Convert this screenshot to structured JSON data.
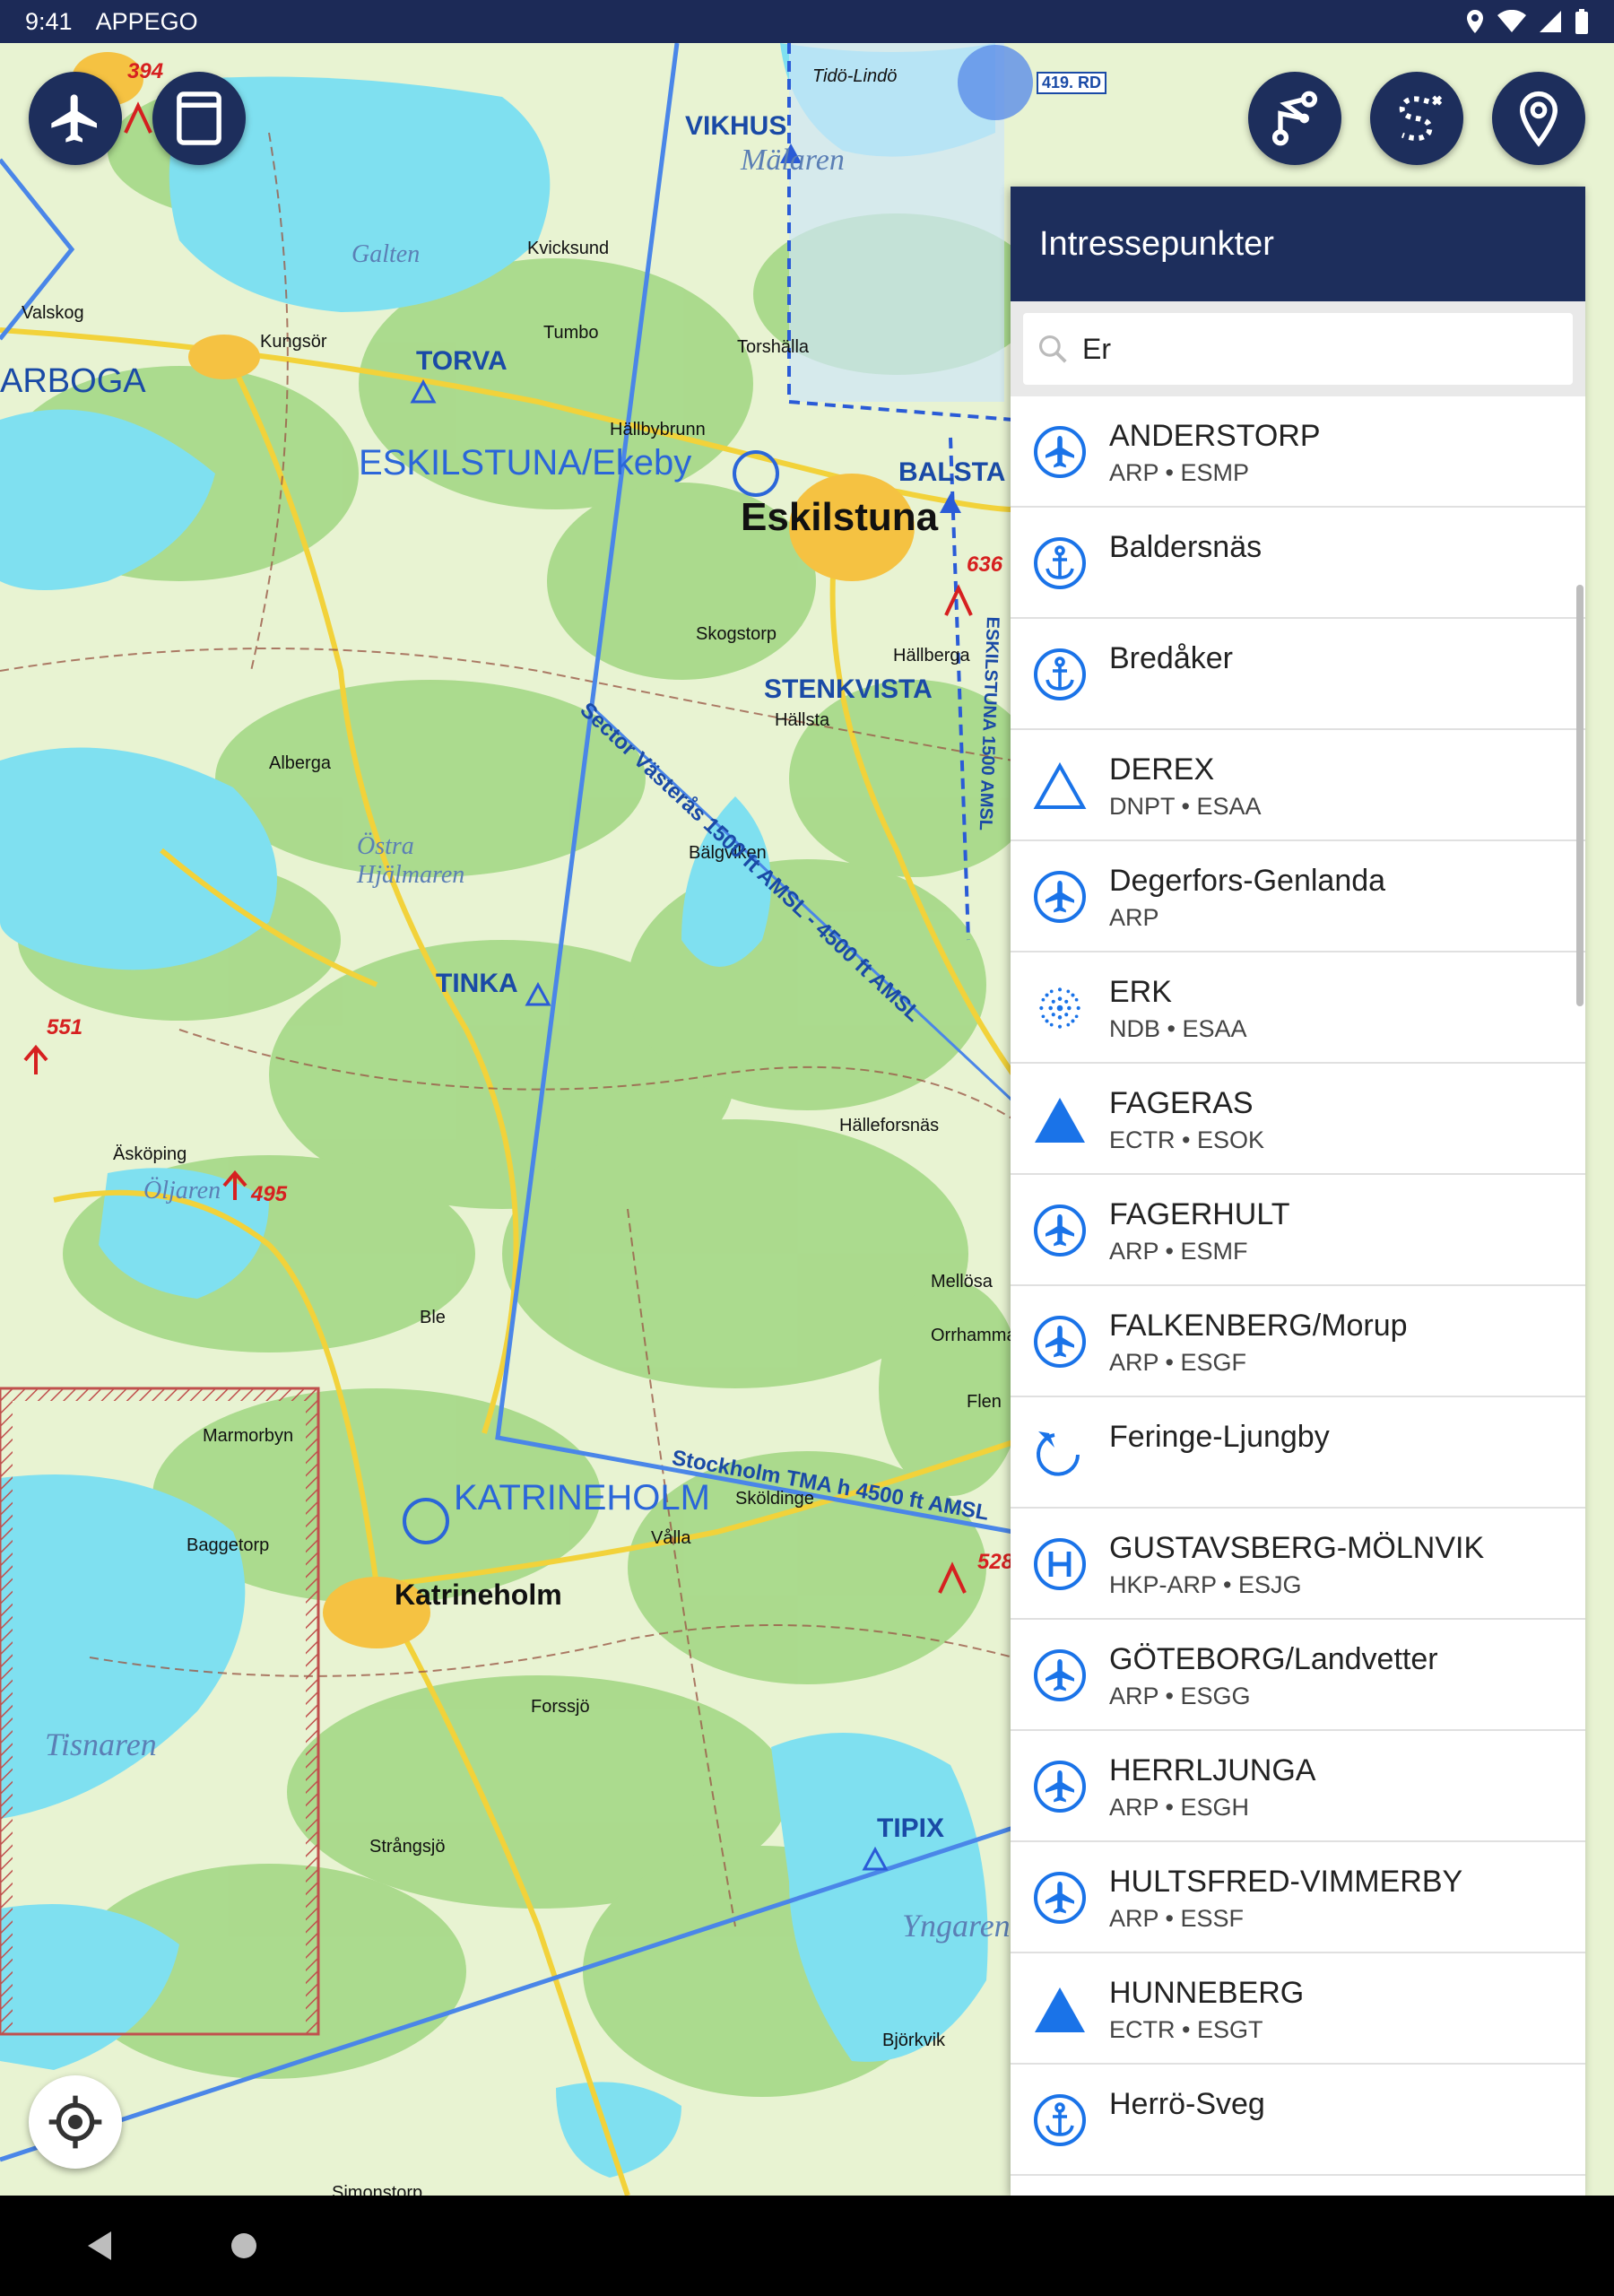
{
  "status_bar": {
    "time": "9:41",
    "app": "APPEGO"
  },
  "map_labels": {
    "towns": [
      "Kvicksund",
      "Kungsör",
      "Tumbo",
      "Torshälla",
      "Valskog",
      "Hällbybrunn",
      "Skogstorp",
      "Hällberga",
      "Hällsta",
      "Alberga",
      "Bälgviken",
      "Hälleforsnäs",
      "Äsköping",
      "Mellösa",
      "Orrhammar",
      "Flen",
      "Ble",
      "Marmorbyn",
      "Baggetorp",
      "Vålla",
      "Sköldinge",
      "Forssjö",
      "Strångsjö",
      "Björkvik",
      "Simonstorp",
      "Tidö-Lindö"
    ],
    "big_town": "Eskilstuna",
    "town_katrineholm": "Katrineholm",
    "lakes": [
      "Galten",
      "Mälaren",
      "Östra Hjälmaren",
      "Öljaren",
      "Tisnaren",
      "Yngaren"
    ],
    "waypoints": [
      "VIKHUS",
      "TORVA",
      "BALSTA",
      "STENKVISTA",
      "TINKA",
      "TIPIX",
      "ARBOGA"
    ],
    "airports": [
      "ESKILSTUNA/Ekeby",
      "KATRINEHOLM"
    ],
    "sectors": [
      "Sector Västerås 1500 ft AMSL - 4500 ft AMSL",
      "Stockholm TMA h 4500 ft AMSL",
      "ESKILSTUNA 1500 AMSL"
    ],
    "obstacles": [
      "394",
      "636",
      "551",
      "495",
      "528"
    ],
    "restricted": "419. RD"
  },
  "poi_panel": {
    "title": "Intressepunkter",
    "search": {
      "value": "Er"
    },
    "items": [
      {
        "name": "ANDERSTORP",
        "sub": "ARP • ESMP",
        "icon": "airport-icon"
      },
      {
        "name": "Baldersnäs",
        "sub": "",
        "icon": "anchor-icon"
      },
      {
        "name": "Bredåker",
        "sub": "",
        "icon": "anchor-icon"
      },
      {
        "name": "DEREX",
        "sub": "DNPT • ESAA",
        "icon": "triangle-outline-icon"
      },
      {
        "name": "Degerfors-Genlanda",
        "sub": "ARP",
        "icon": "airport-icon"
      },
      {
        "name": "ERK",
        "sub": "NDB • ESAA",
        "icon": "ndb-icon"
      },
      {
        "name": "FAGERAS",
        "sub": "ECTR • ESOK",
        "icon": "triangle-filled-icon"
      },
      {
        "name": "FAGERHULT",
        "sub": "ARP • ESMF",
        "icon": "airport-icon"
      },
      {
        "name": "FALKENBERG/Morup",
        "sub": "ARP • ESGF",
        "icon": "airport-icon"
      },
      {
        "name": "Feringe-Ljungby",
        "sub": "",
        "icon": "glider-icon"
      },
      {
        "name": "GUSTAVSBERG-MÖLNVIK",
        "sub": "HKP-ARP • ESJG",
        "icon": "heliport-icon"
      },
      {
        "name": "GÖTEBORG/Landvetter",
        "sub": "ARP • ESGG",
        "icon": "airport-icon"
      },
      {
        "name": "HERRLJUNGA",
        "sub": "ARP • ESGH",
        "icon": "airport-icon"
      },
      {
        "name": "HULTSFRED-VIMMERBY",
        "sub": "ARP • ESSF",
        "icon": "airport-icon"
      },
      {
        "name": "HUNNEBERG",
        "sub": "ECTR • ESGT",
        "icon": "triangle-filled-icon"
      },
      {
        "name": "Herrö-Sveg",
        "sub": "",
        "icon": "anchor-icon"
      }
    ]
  },
  "colors": {
    "header": "#1d2e5c",
    "accent": "#1a73e8",
    "water": "#7fe0f0",
    "land": "#e8f3d2",
    "forest": "#a8d98a"
  }
}
